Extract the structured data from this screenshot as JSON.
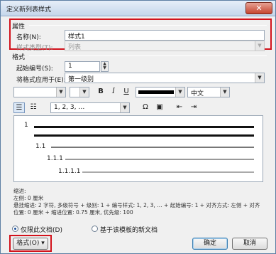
{
  "window": {
    "title": "定义新列表样式",
    "close_glyph": "✕"
  },
  "properties": {
    "group_label": "属性",
    "name_label": "名称(N):",
    "name_value": "样式1",
    "style_type_label": "样式类型(T):",
    "style_type_value": "列表"
  },
  "format": {
    "group_label": "格式",
    "start_at_label": "起始编号(S):",
    "start_at_value": "1",
    "apply_to_label": "将格式应用于(E):",
    "apply_to_value": "第一级别",
    "bold_label": "B",
    "italic_label": "I",
    "underline_label": "U",
    "language_value": "中文",
    "numbering_style_value": "1, 2, 3, …",
    "symbol_glyph": "Ω"
  },
  "preview": {
    "levels": [
      "1",
      "1.1",
      "1.1.1",
      "1.1.1.1"
    ]
  },
  "description": {
    "heading": "缩进:",
    "text": "左侧: 0 厘米\n悬挂缩进: 2 字符, 多级符号 + 级别: 1 + 编号样式: 1, 2, 3, … + 起始编号: 1 + 对齐方式: 左侧 + 对齐位置: 0 厘米 + 缩进位置: 0.75 厘米, 优先级: 100"
  },
  "options": {
    "only_this_doc_label": "仅限此文档(D)",
    "new_docs_label": "基于该模板的新文档"
  },
  "buttons": {
    "format_label": "格式(O) ▾",
    "ok_label": "确定",
    "cancel_label": "取消"
  },
  "colors": {
    "highlight_red": "#d2121b",
    "title_gradient_top": "#e6eef8"
  }
}
